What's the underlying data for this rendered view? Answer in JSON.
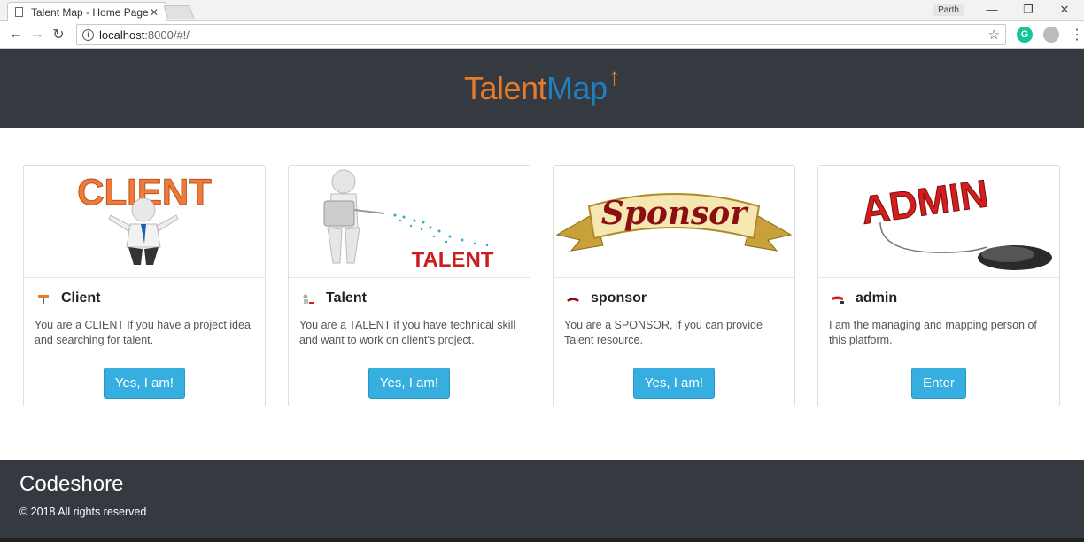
{
  "browser": {
    "tab_title": "Talent Map - Home Page",
    "tab_close": "✕",
    "profile_name": "Parth",
    "url_host": "localhost",
    "url_path": ":8000/#!/"
  },
  "header": {
    "logo_part1": "Talent",
    "logo_part2": "Map",
    "logo_arrow": "↑"
  },
  "cards": [
    {
      "image_label": "CLIENT",
      "title": "Client",
      "description": "You are a CLIENT If you have a project idea and searching for talent.",
      "button": "Yes, I am!"
    },
    {
      "image_label": "TALENT",
      "title": "Talent",
      "description": "You are a TALENT if you have technical skill and want to work on client's project.",
      "button": "Yes, I am!"
    },
    {
      "image_label": "Sponsor",
      "title": "sponsor",
      "description": "You are a SPONSOR, if you can provide Talent resource.",
      "button": "Yes, I am!"
    },
    {
      "image_label": "ADMIN",
      "title": "admin",
      "description": "I am the managing and mapping person of this platform.",
      "button": "Enter"
    }
  ],
  "footer": {
    "company": "Codeshore",
    "copyright": "© 2018 All rights reserved"
  },
  "colors": {
    "header_bg": "#353940",
    "logo_orange": "#e77b2d",
    "logo_blue": "#1f7fbf",
    "button": "#36aee0"
  }
}
